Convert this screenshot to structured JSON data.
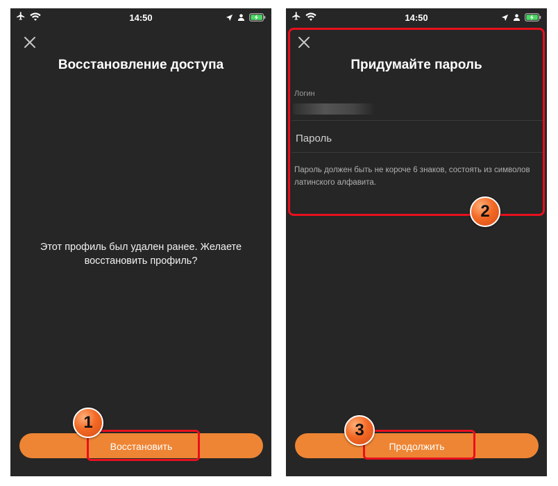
{
  "status_bar": {
    "time": "14:50"
  },
  "left_screen": {
    "title": "Восстановление доступа",
    "message": "Этот профиль был удален ранее. Желаете восстановить профиль?",
    "restore_button_label": "Восстановить"
  },
  "right_screen": {
    "title": "Придумайте пароль",
    "login_label": "Логин",
    "password_placeholder": "Пароль",
    "hint": "Пароль должен быть не короче 6 знаков, состоять из символов латинского алфавита.",
    "continue_button_label": "Продолжить"
  },
  "annotations": {
    "step1": "1",
    "step2": "2",
    "step3": "3"
  },
  "colors": {
    "background": "#262626",
    "accent": "#ee8534",
    "highlight": "#e8101d",
    "battery": "#4cd964"
  },
  "icons": [
    "airplane-icon",
    "wifi-icon",
    "location-icon",
    "person-icon",
    "battery-charging-icon",
    "close-icon"
  ]
}
